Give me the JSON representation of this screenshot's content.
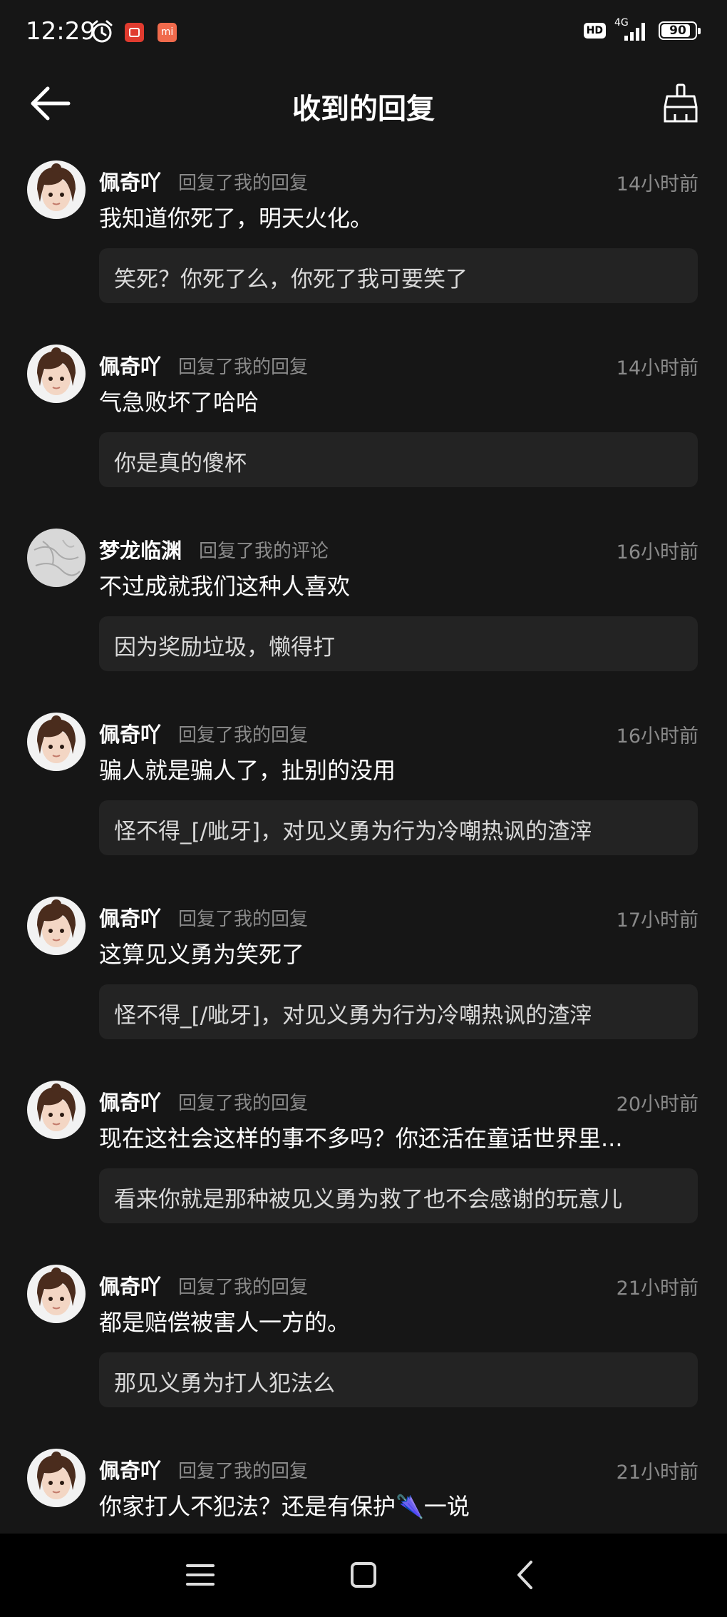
{
  "status_bar": {
    "time": "12:29",
    "hd_label": "HD",
    "network": "4G",
    "battery": "90",
    "app_icon_label": "mi"
  },
  "header": {
    "title": "收到的回复"
  },
  "replies": [
    {
      "user": "佩奇吖",
      "action": "回复了我的回复",
      "time": "14小时前",
      "text": "我知道你死了，明天火化。",
      "quote": "笑死？你死了么，你死了我可要笑了",
      "avatar": "girl"
    },
    {
      "user": "佩奇吖",
      "action": "回复了我的回复",
      "time": "14小时前",
      "text": "气急败坏了哈哈",
      "quote": "你是真的傻杯",
      "avatar": "girl"
    },
    {
      "user": "梦龙临渊",
      "action": "回复了我的评论",
      "time": "16小时前",
      "text": "不过成就我们这种人喜欢",
      "quote": "因为奖励垃圾，懒得打",
      "avatar": "gray"
    },
    {
      "user": "佩奇吖",
      "action": "回复了我的回复",
      "time": "16小时前",
      "text": "骗人就是骗人了，扯别的没用",
      "quote": "怪不得_[/呲牙]，对见义勇为行为冷嘲热讽的渣滓",
      "avatar": "girl"
    },
    {
      "user": "佩奇吖",
      "action": "回复了我的回复",
      "time": "17小时前",
      "text": "这算见义勇为笑死了",
      "quote": "怪不得_[/呲牙]，对见义勇为行为冷嘲热讽的渣滓",
      "avatar": "girl"
    },
    {
      "user": "佩奇吖",
      "action": "回复了我的回复",
      "time": "20小时前",
      "text": "现在这社会这样的事不多吗？你还活在童话世界里...",
      "quote": "看来你就是那种被见义勇为救了也不会感谢的玩意儿",
      "avatar": "girl"
    },
    {
      "user": "佩奇吖",
      "action": "回复了我的回复",
      "time": "21小时前",
      "text": "都是赔偿被害人一方的。",
      "quote": "那见义勇为打人犯法么",
      "avatar": "girl"
    },
    {
      "user": "佩奇吖",
      "action": "回复了我的回复",
      "time": "21小时前",
      "text": "你家打人不犯法？还是有保护🌂一说",
      "quote": "",
      "avatar": "girl"
    }
  ],
  "icons": {
    "back": "arrow-left-icon",
    "clear": "broom-icon",
    "nav_menu": "menu-icon",
    "nav_home": "home-icon",
    "nav_back": "chevron-left-icon"
  },
  "colors": {
    "background": "#161616",
    "quote_background": "#232323",
    "secondary_text": "#8a8a8a"
  }
}
